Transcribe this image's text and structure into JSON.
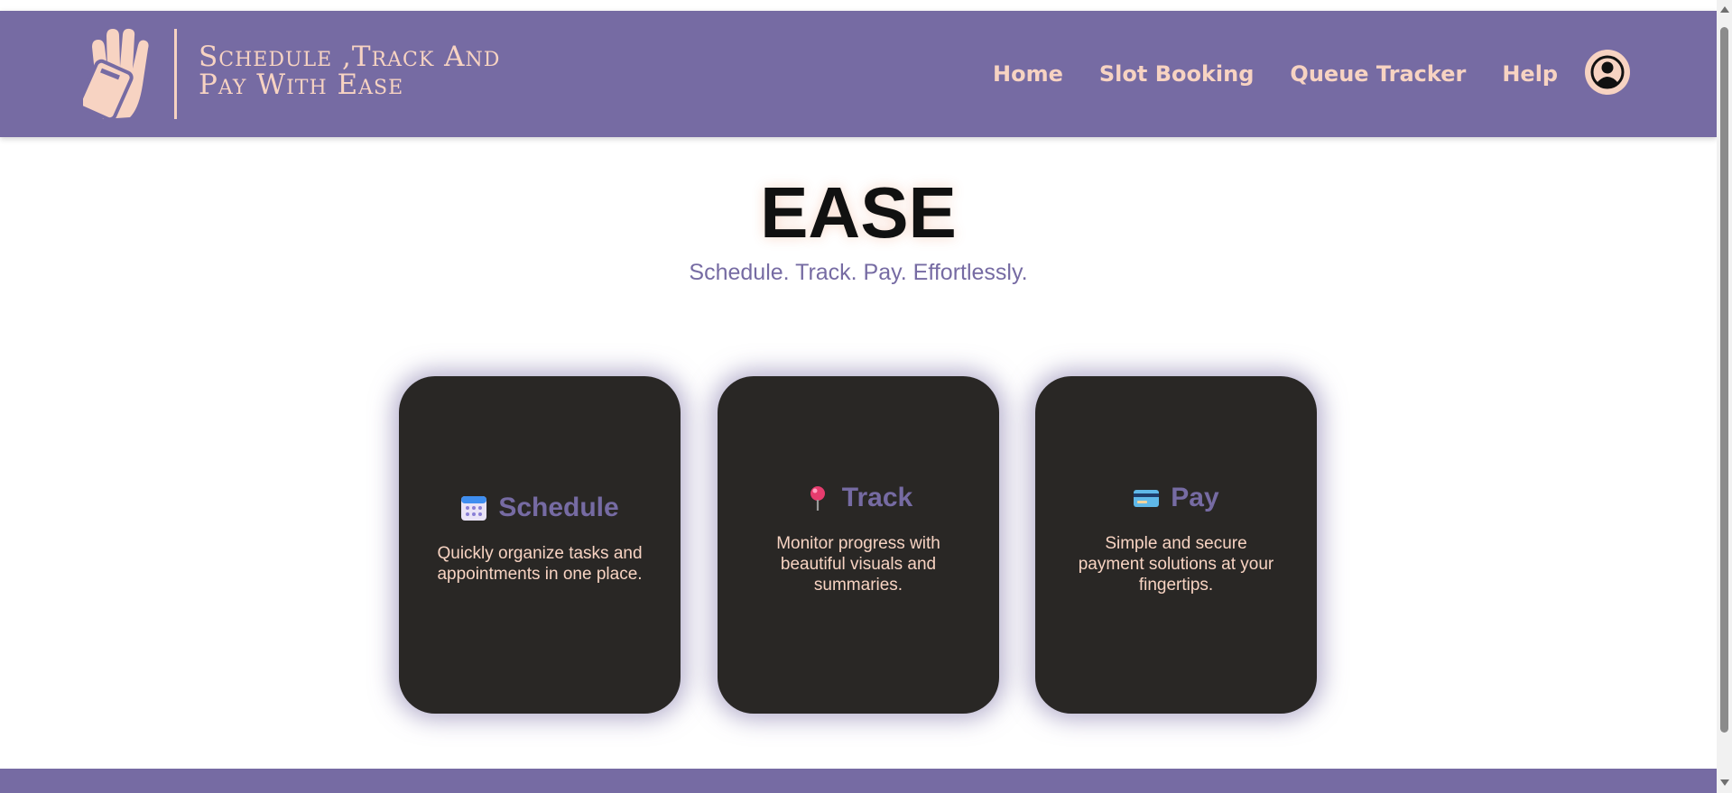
{
  "header": {
    "brand_line1": "Schedule ,Track And",
    "brand_line2": "Pay With Ease",
    "nav": [
      {
        "label": "Home"
      },
      {
        "label": "Slot Booking"
      },
      {
        "label": "Queue Tracker"
      },
      {
        "label": "Help"
      }
    ],
    "account_icon": "user-circle-icon",
    "logo_icon": "hand-card-icon"
  },
  "hero": {
    "title": "EASE",
    "subtitle": "Schedule. Track. Pay. Effortlessly."
  },
  "cards": [
    {
      "icon": "calendar-icon",
      "title": "Schedule",
      "description": "Quickly organize tasks and appointments in one place."
    },
    {
      "icon": "pin-icon",
      "title": "Track",
      "description": "Monitor progress with beautiful visuals and summaries."
    },
    {
      "icon": "credit-card-icon",
      "title": "Pay",
      "description": "Simple and secure payment solutions at your fingertips."
    }
  ],
  "colors": {
    "primary": "#766ba3",
    "accent": "#f7d3c2",
    "card_bg": "#292725",
    "title": "#111111"
  }
}
